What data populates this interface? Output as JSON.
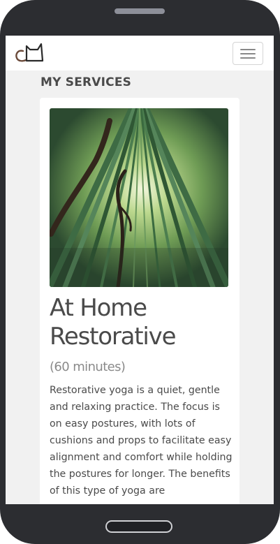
{
  "navbar": {
    "logo_icon": "cat-logo-icon",
    "menu_icon": "hamburger-menu-icon"
  },
  "section": {
    "title": "MY SERVICES"
  },
  "service": {
    "image_subject": "bamboo-forest-photo",
    "title": "At Home Restorative",
    "duration": "(60 minutes)",
    "description": "Restorative yoga is a quiet, gentle and relaxing practice. The focus is on easy postures, with lots of cushions and props to facilitate easy alignment and comfort while holding the postures for longer. The benefits of this type of yoga are"
  },
  "colors": {
    "phone_frame": "#2c2d31",
    "page_background": "#f1f1f1",
    "text": "#4a4a4a",
    "muted_text": "#8a8a8a"
  }
}
